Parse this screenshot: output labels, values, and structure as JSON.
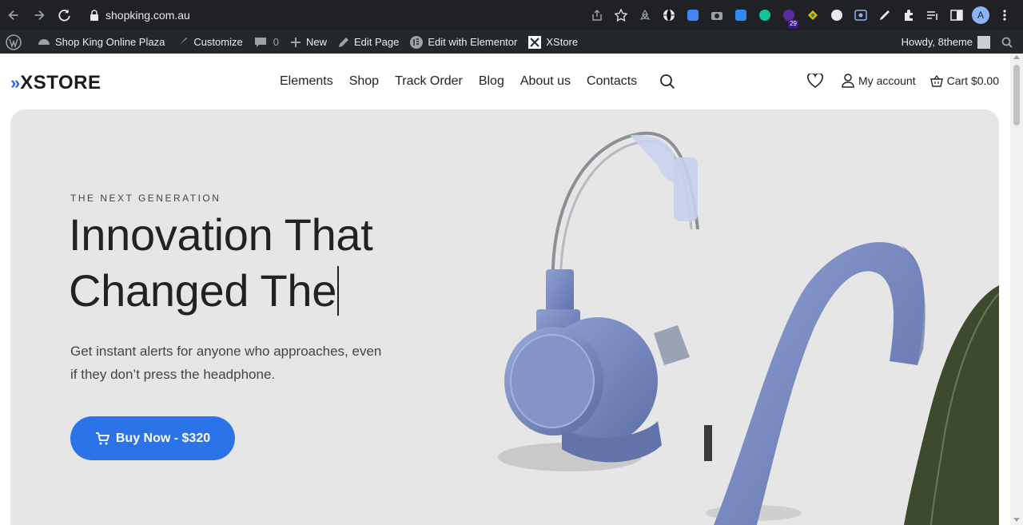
{
  "browser": {
    "url": "shopking.com.au",
    "extension_badge": "29",
    "profile_initial": "A"
  },
  "wp_admin_bar": {
    "site_name": "Shop King Online Plaza",
    "customize": "Customize",
    "comments_count": "0",
    "new": "New",
    "edit_page": "Edit Page",
    "edit_elementor": "Edit with Elementor",
    "xstore": "XStore",
    "howdy": "Howdy, 8theme"
  },
  "header": {
    "logo_text": "XSTORE",
    "nav": [
      "Elements",
      "Shop",
      "Track Order",
      "Blog",
      "About us",
      "Contacts"
    ],
    "my_account": "My account",
    "cart_label": "Cart",
    "cart_total": "$0.00"
  },
  "hero": {
    "eyebrow": "THE NEXT GENERATION",
    "headline_line1": "Innovation That",
    "headline_line2": "Changed The",
    "subtext": "Get instant alerts for anyone who approaches, even if they don’t press the headphone.",
    "button_label": "Buy Now - $320"
  },
  "colors": {
    "accent": "#2b73e8",
    "hero_bg": "#e6e6e6",
    "headphone": "#7b8fc4"
  }
}
